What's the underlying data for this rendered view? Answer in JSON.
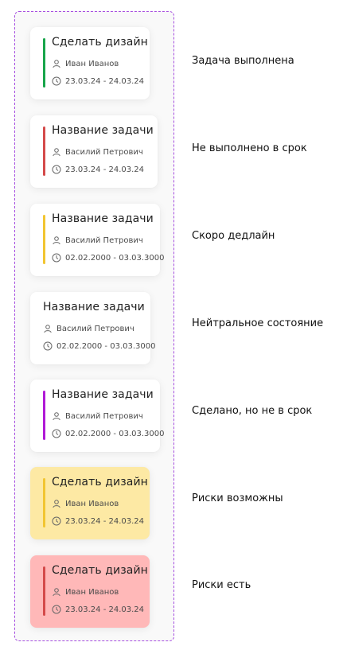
{
  "cards": [
    {
      "title": "Сделать дизайн",
      "person": "Иван Иванов",
      "dates": "23.03.24 - 24.03.24",
      "accent": "#18a54a",
      "background": "#ffffff",
      "state": "Задача выполнена",
      "icons": [
        "user-icon",
        "clock-icon"
      ]
    },
    {
      "title": "Название задачи",
      "person": "Василий Петрович",
      "dates": "23.03.24 - 24.03.24",
      "accent": "#d44a4a",
      "background": "#ffffff",
      "state": "Не выполнено в срок",
      "icons": [
        "user-icon",
        "clock-icon"
      ]
    },
    {
      "title": "Название задачи",
      "person": "Василий Петрович",
      "dates": "02.02.2000 - 03.03.3000",
      "accent": "#f2c531",
      "background": "#ffffff",
      "state": "Скоро дедлайн",
      "icons": [
        "user-icon",
        "clock-icon"
      ]
    },
    {
      "title": "Название задачи",
      "person": "Василий Петрович",
      "dates": "02.02.2000 - 03.03.3000",
      "accent": "",
      "background": "#ffffff",
      "state": "Нейтральное состояние",
      "icons": [
        "user-icon",
        "clock-icon"
      ]
    },
    {
      "title": "Название задачи",
      "person": "Василий Петрович",
      "dates": "02.02.2000 - 03.03.3000",
      "accent": "#b01ad6",
      "background": "#ffffff",
      "state": "Сделано, но не в срок",
      "icons": [
        "user-icon",
        "clock-icon"
      ]
    },
    {
      "title": "Сделать дизайн",
      "person": "Иван Иванов",
      "dates": "23.03.24 - 24.03.24",
      "accent": "#f2c531",
      "background": "#fde9a4",
      "state": "Риски возможны",
      "icons": [
        "user-icon",
        "clock-icon"
      ]
    },
    {
      "title": "Сделать дизайн",
      "person": "Иван Иванов",
      "dates": "23.03.24 - 24.03.24",
      "accent": "#d44a4a",
      "background": "#ffb8b8",
      "state": "Риски есть",
      "icons": [
        "user-icon",
        "clock-icon"
      ]
    }
  ]
}
